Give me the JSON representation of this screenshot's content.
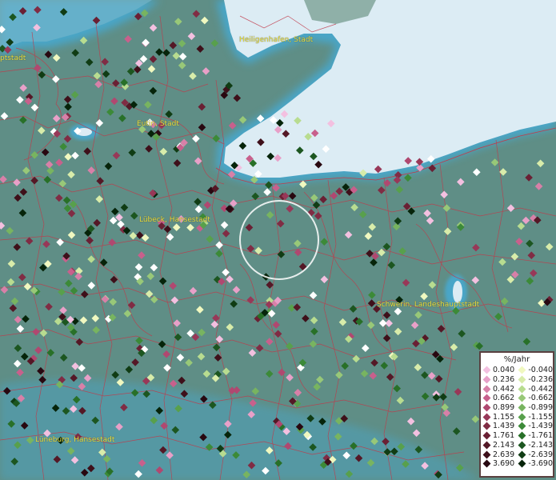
{
  "cities": [
    {
      "id": "heiligenhafen",
      "label": "Heiligenhafen, Stadt"
    },
    {
      "id": "eutin",
      "label": "Eutin, Stadt"
    },
    {
      "id": "luebeck",
      "label": "Lübeck, Hansestadt"
    },
    {
      "id": "schwerin",
      "label": "Schwerin, Landeshauptstadt"
    },
    {
      "id": "lueneburg",
      "label": "Lüneburg, Hansestadt"
    },
    {
      "id": "edge",
      "label": "ptstadt"
    }
  ],
  "legend": {
    "title": "%/Jahr",
    "positive": [
      {
        "label": "0.040",
        "color": "#f3c0e0"
      },
      {
        "label": "0.236",
        "color": "#e8a0c8"
      },
      {
        "label": "0.442",
        "color": "#d880a8"
      },
      {
        "label": "0.662",
        "color": "#c8608c"
      },
      {
        "label": "0.899",
        "color": "#b04870"
      },
      {
        "label": "1.155",
        "color": "#983858"
      },
      {
        "label": "1.439",
        "color": "#802c44"
      },
      {
        "label": "1.761",
        "color": "#6a2034"
      },
      {
        "label": "2.143",
        "color": "#541826"
      },
      {
        "label": "2.639",
        "color": "#3e101a"
      },
      {
        "label": "3.690",
        "color": "#280810"
      }
    ],
    "negative": [
      {
        "label": "-0.040",
        "color": "#f0f8c0"
      },
      {
        "label": "-0.236",
        "color": "#d8ecaa"
      },
      {
        "label": "-0.442",
        "color": "#b8dc90"
      },
      {
        "label": "-0.662",
        "color": "#98c878"
      },
      {
        "label": "-0.899",
        "color": "#78b460"
      },
      {
        "label": "-1.155",
        "color": "#58a04c"
      },
      {
        "label": "-1.439",
        "color": "#3c8a38"
      },
      {
        "label": "-1.761",
        "color": "#287028"
      },
      {
        "label": "-2.143",
        "color": "#1c5620"
      },
      {
        "label": "-2.639",
        "color": "#103c14"
      },
      {
        "label": "-3.690",
        "color": "#06240a"
      }
    ]
  },
  "colors": {
    "sea": "#dcecf4",
    "land": "#5f8e86",
    "coast": "#4aa6c8",
    "borders": "#c03a4a",
    "label": "#e8e040",
    "highlight": "#ffffff"
  }
}
